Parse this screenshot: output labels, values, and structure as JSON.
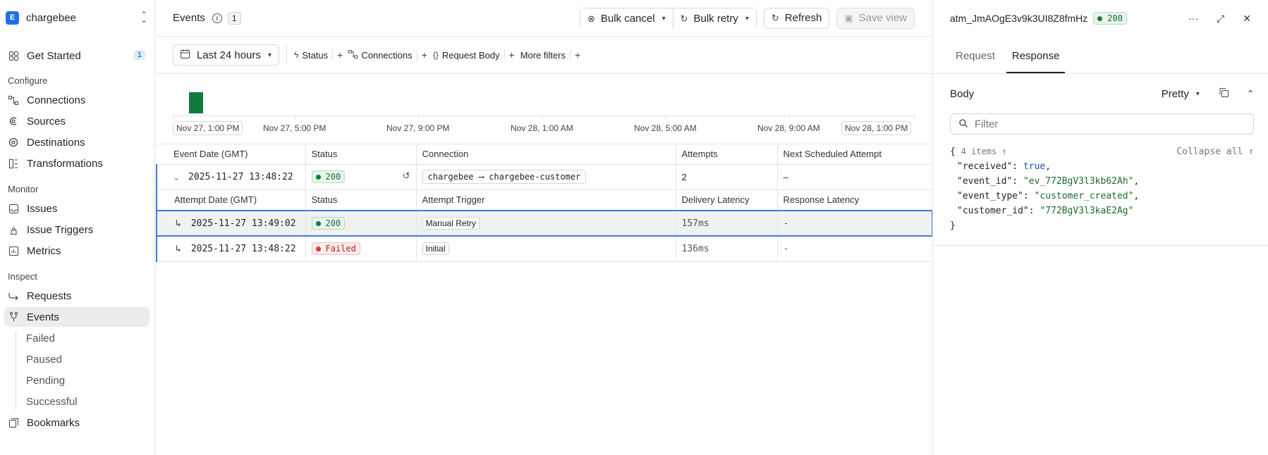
{
  "org": {
    "initial": "E",
    "name": "chargebee"
  },
  "sidebar": {
    "get_started": {
      "label": "Get Started",
      "badge": "1"
    },
    "sections": {
      "configure": "Configure",
      "monitor": "Monitor",
      "inspect": "Inspect"
    },
    "items": {
      "connections": "Connections",
      "sources": "Sources",
      "destinations": "Destinations",
      "transformations": "Transformations",
      "issues": "Issues",
      "issue_triggers": "Issue Triggers",
      "metrics": "Metrics",
      "requests": "Requests",
      "events": "Events",
      "failed": "Failed",
      "paused": "Paused",
      "pending": "Pending",
      "successful": "Successful",
      "bookmarks": "Bookmarks"
    }
  },
  "header": {
    "title": "Events",
    "count": "1",
    "bulk_cancel": "Bulk cancel",
    "bulk_retry": "Bulk retry",
    "refresh": "Refresh",
    "save_view": "Save view"
  },
  "filters": {
    "range": "Last 24 hours",
    "status": "Status",
    "connections": "Connections",
    "request_body": "Request Body",
    "more": "More filters"
  },
  "histogram": {
    "labels": [
      "Nov 27, 1:00 PM",
      "Nov 27, 5:00 PM",
      "Nov 27, 9:00 PM",
      "Nov 28, 1:00 AM",
      "Nov 28, 5:00 AM",
      "Nov 28, 9:00 AM",
      "Nov 28, 1:00 PM"
    ]
  },
  "table": {
    "columns": [
      "Event Date (GMT)",
      "Status",
      "Connection",
      "Attempts",
      "Next Scheduled Attempt"
    ],
    "event": {
      "date": "2025-11-27 13:48:22",
      "status": "200",
      "source": "chargebee",
      "arrow": "⟶",
      "destination": "chargebee-customer",
      "attempts": "2",
      "next": "–"
    },
    "attempt_columns": [
      "Attempt Date (GMT)",
      "Status",
      "Attempt Trigger",
      "Delivery Latency",
      "Response Latency"
    ],
    "attempts": [
      {
        "date": "2025-11-27 13:49:02",
        "status": "200",
        "trigger": "Manual Retry",
        "delivery": "157ms",
        "response": "-"
      },
      {
        "date": "2025-11-27 13:48:22",
        "status": "Failed",
        "trigger": "Initial",
        "delivery": "136ms",
        "response": "-"
      }
    ]
  },
  "panel": {
    "id": "atm_JmAOgE3v9k3UI8Z8fmHz",
    "status": "200",
    "tabs": [
      "Request",
      "Response"
    ],
    "body_title": "Body",
    "format": "Pretty",
    "filter_placeholder": "Filter",
    "json_meta": "4 items ↑",
    "collapse_all": "Collapse all ↑",
    "json": {
      "k1": "\"received\"",
      "v1": "true",
      "k2": "\"event_id\"",
      "v2": "\"ev_772BgV3l3kb62Ah\"",
      "k3": "\"event_type\"",
      "v3": "\"customer_created\"",
      "k4": "\"customer_id\"",
      "v4": "\"772BgV3l3kaE2Ag\""
    }
  }
}
